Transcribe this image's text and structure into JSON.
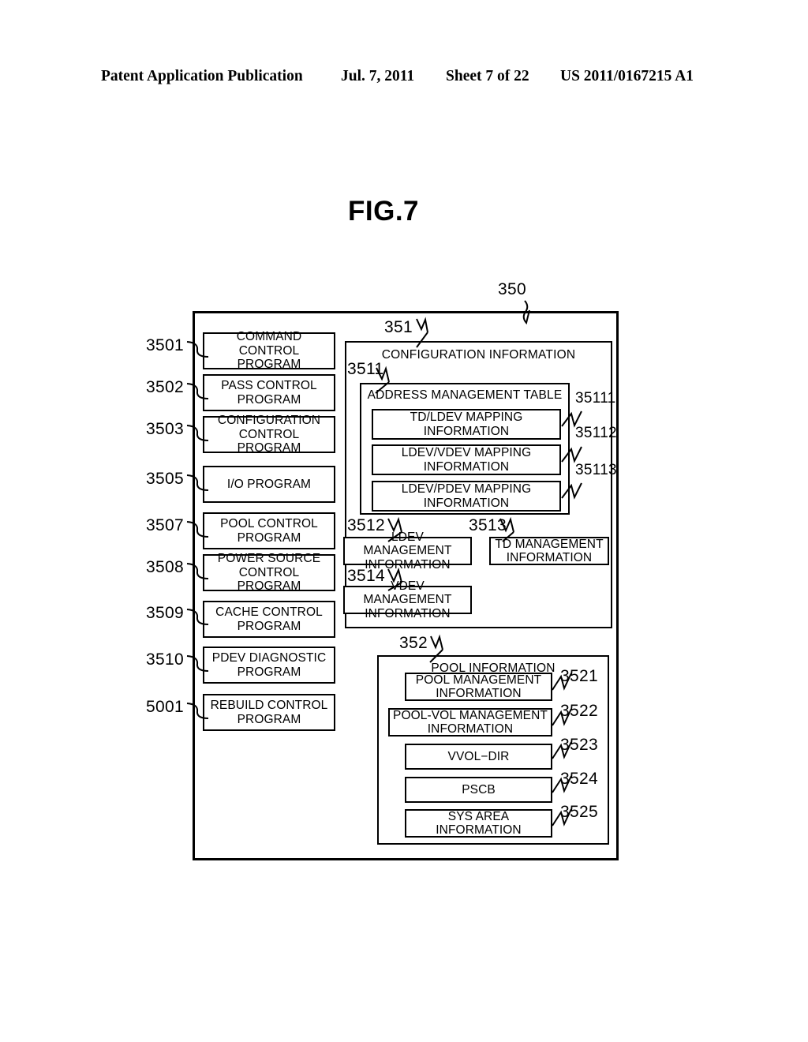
{
  "header": {
    "left": "Patent Application Publication",
    "date": "Jul. 7, 2011",
    "sheet": "Sheet 7 of 22",
    "serial": "US 2011/0167215 A1"
  },
  "figure": {
    "title": "FIG.7",
    "memory_ref": "350"
  },
  "programs": [
    {
      "ref": "3501",
      "label": "COMMAND  CONTROL\nPROGRAM",
      "line1": "COMMAND  CONTROL",
      "line2": "PROGRAM"
    },
    {
      "ref": "3502",
      "label": "PASS CONTROL\nPROGRAM",
      "line1": "PASS CONTROL",
      "line2": "PROGRAM"
    },
    {
      "ref": "3503",
      "label": "CONFIGURATION\nCONTROL PROGRAM",
      "line1": "CONFIGURATION",
      "line2": "CONTROL PROGRAM"
    },
    {
      "ref": "3505",
      "label": "I/O PROGRAM",
      "line1": "I/O PROGRAM",
      "line2": ""
    },
    {
      "ref": "3507",
      "label": "POOL  CONTROL\nPROGRAM",
      "line1": "POOL  CONTROL",
      "line2": "PROGRAM"
    },
    {
      "ref": "3508",
      "label": "POWER SOURCE\nCONTROL  PROGRAM",
      "line1": "POWER SOURCE",
      "line2": "CONTROL  PROGRAM"
    },
    {
      "ref": "3509",
      "label": "CACHE CONTROL\nPROGRAM",
      "line1": "CACHE CONTROL",
      "line2": "PROGRAM"
    },
    {
      "ref": "3510",
      "label": "PDEV DIAGNOSTIC\nPROGRAM",
      "line1": "PDEV DIAGNOSTIC",
      "line2": "PROGRAM"
    },
    {
      "ref": "5001",
      "label": "REBUILD CONTROL\nPROGRAM",
      "line1": "REBUILD CONTROL",
      "line2": "PROGRAM"
    }
  ],
  "configuration": {
    "ref": "351",
    "title": "CONFIGURATION INFORMATION",
    "address_table": {
      "ref": "3511",
      "title": "ADDRESS MANAGEMENT TABLE",
      "entries": [
        {
          "ref": "35111",
          "line1": "TD/LDEV MAPPING",
          "line2": "INFORMATION"
        },
        {
          "ref": "35112",
          "line1": "LDEV/VDEV MAPPING",
          "line2": "INFORMATION"
        },
        {
          "ref": "35113",
          "line1": "LDEV/PDEV MAPPING",
          "line2": "INFORMATION"
        }
      ]
    },
    "management": [
      {
        "ref": "3512",
        "line1": "LDEV MANAGEMENT",
        "line2": "INFORMATION"
      },
      {
        "ref": "3513",
        "line1": "TD MANAGEMENT",
        "line2": "INFORMATION"
      },
      {
        "ref": "3514",
        "line1": "VDEV MANAGEMENT",
        "line2": "INFORMATION"
      }
    ]
  },
  "pool": {
    "ref": "352",
    "title": "POOL INFORMATION",
    "entries": [
      {
        "ref": "3521",
        "line1": "POOL MANAGEMENT",
        "line2": "INFORMATION"
      },
      {
        "ref": "3522",
        "line1": "POOL-VOL MANAGEMENT",
        "line2": "INFORMATION"
      },
      {
        "ref": "3523",
        "line1": "VVOL−DIR",
        "line2": ""
      },
      {
        "ref": "3524",
        "line1": "PSCB",
        "line2": ""
      },
      {
        "ref": "3525",
        "line1": "SYS AREA",
        "line2": "INFORMATION"
      }
    ]
  }
}
